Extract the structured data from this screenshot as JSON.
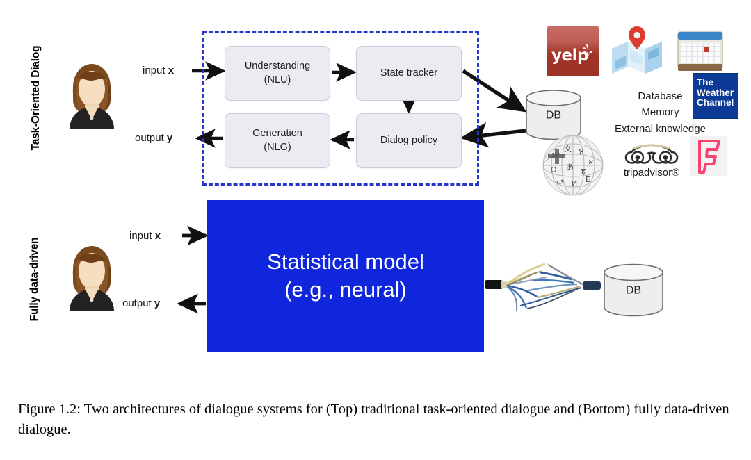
{
  "figure": {
    "caption": "Figure 1.2: Two architectures of dialogue systems for (Top) traditional task-oriented dialogue and (Bottom) fully data-driven dialogue."
  },
  "rows": {
    "top_label": "Task-Oriented Dialog",
    "bottom_label": "Fully data-driven"
  },
  "top_architecture": {
    "input_label_text": "input ",
    "input_label_var": "x",
    "output_label_text": "output ",
    "output_label_var": "y",
    "modules": [
      {
        "line1": "Understanding",
        "line2": "(NLU)"
      },
      {
        "line1": "State tracker",
        "line2": ""
      },
      {
        "line1": "Generation",
        "line2": "(NLG)"
      },
      {
        "line1": "Dialog policy",
        "line2": ""
      }
    ],
    "db_label": "DB",
    "knowledge_lines": [
      "Database",
      "Memory",
      "External knowledge"
    ],
    "logos": [
      {
        "name": "yelp",
        "word": "yelp"
      },
      {
        "name": "maps",
        "word": ""
      },
      {
        "name": "calendar",
        "word": ""
      },
      {
        "name": "weather-channel",
        "line1": "The",
        "line2": "Weather",
        "line3": "Channel"
      },
      {
        "name": "wikipedia",
        "word": ""
      },
      {
        "name": "tripadvisor",
        "word": "tripadvisor®"
      },
      {
        "name": "foursquare",
        "word": ""
      }
    ]
  },
  "bottom_architecture": {
    "input_label_text": "input ",
    "input_label_var": "x",
    "output_label_text": "output ",
    "output_label_var": "y",
    "model_line1": "Statistical model",
    "model_line2": "(e.g., neural)",
    "db_label": "DB"
  },
  "colors": {
    "dashed_border": "#2a34cf",
    "model_fill": "#1026dd",
    "module_fill": "#ebebf1",
    "weather_blue": "#0c3a97",
    "yelp_red": "#a33428",
    "foursquare_pink": "#f9426e"
  }
}
